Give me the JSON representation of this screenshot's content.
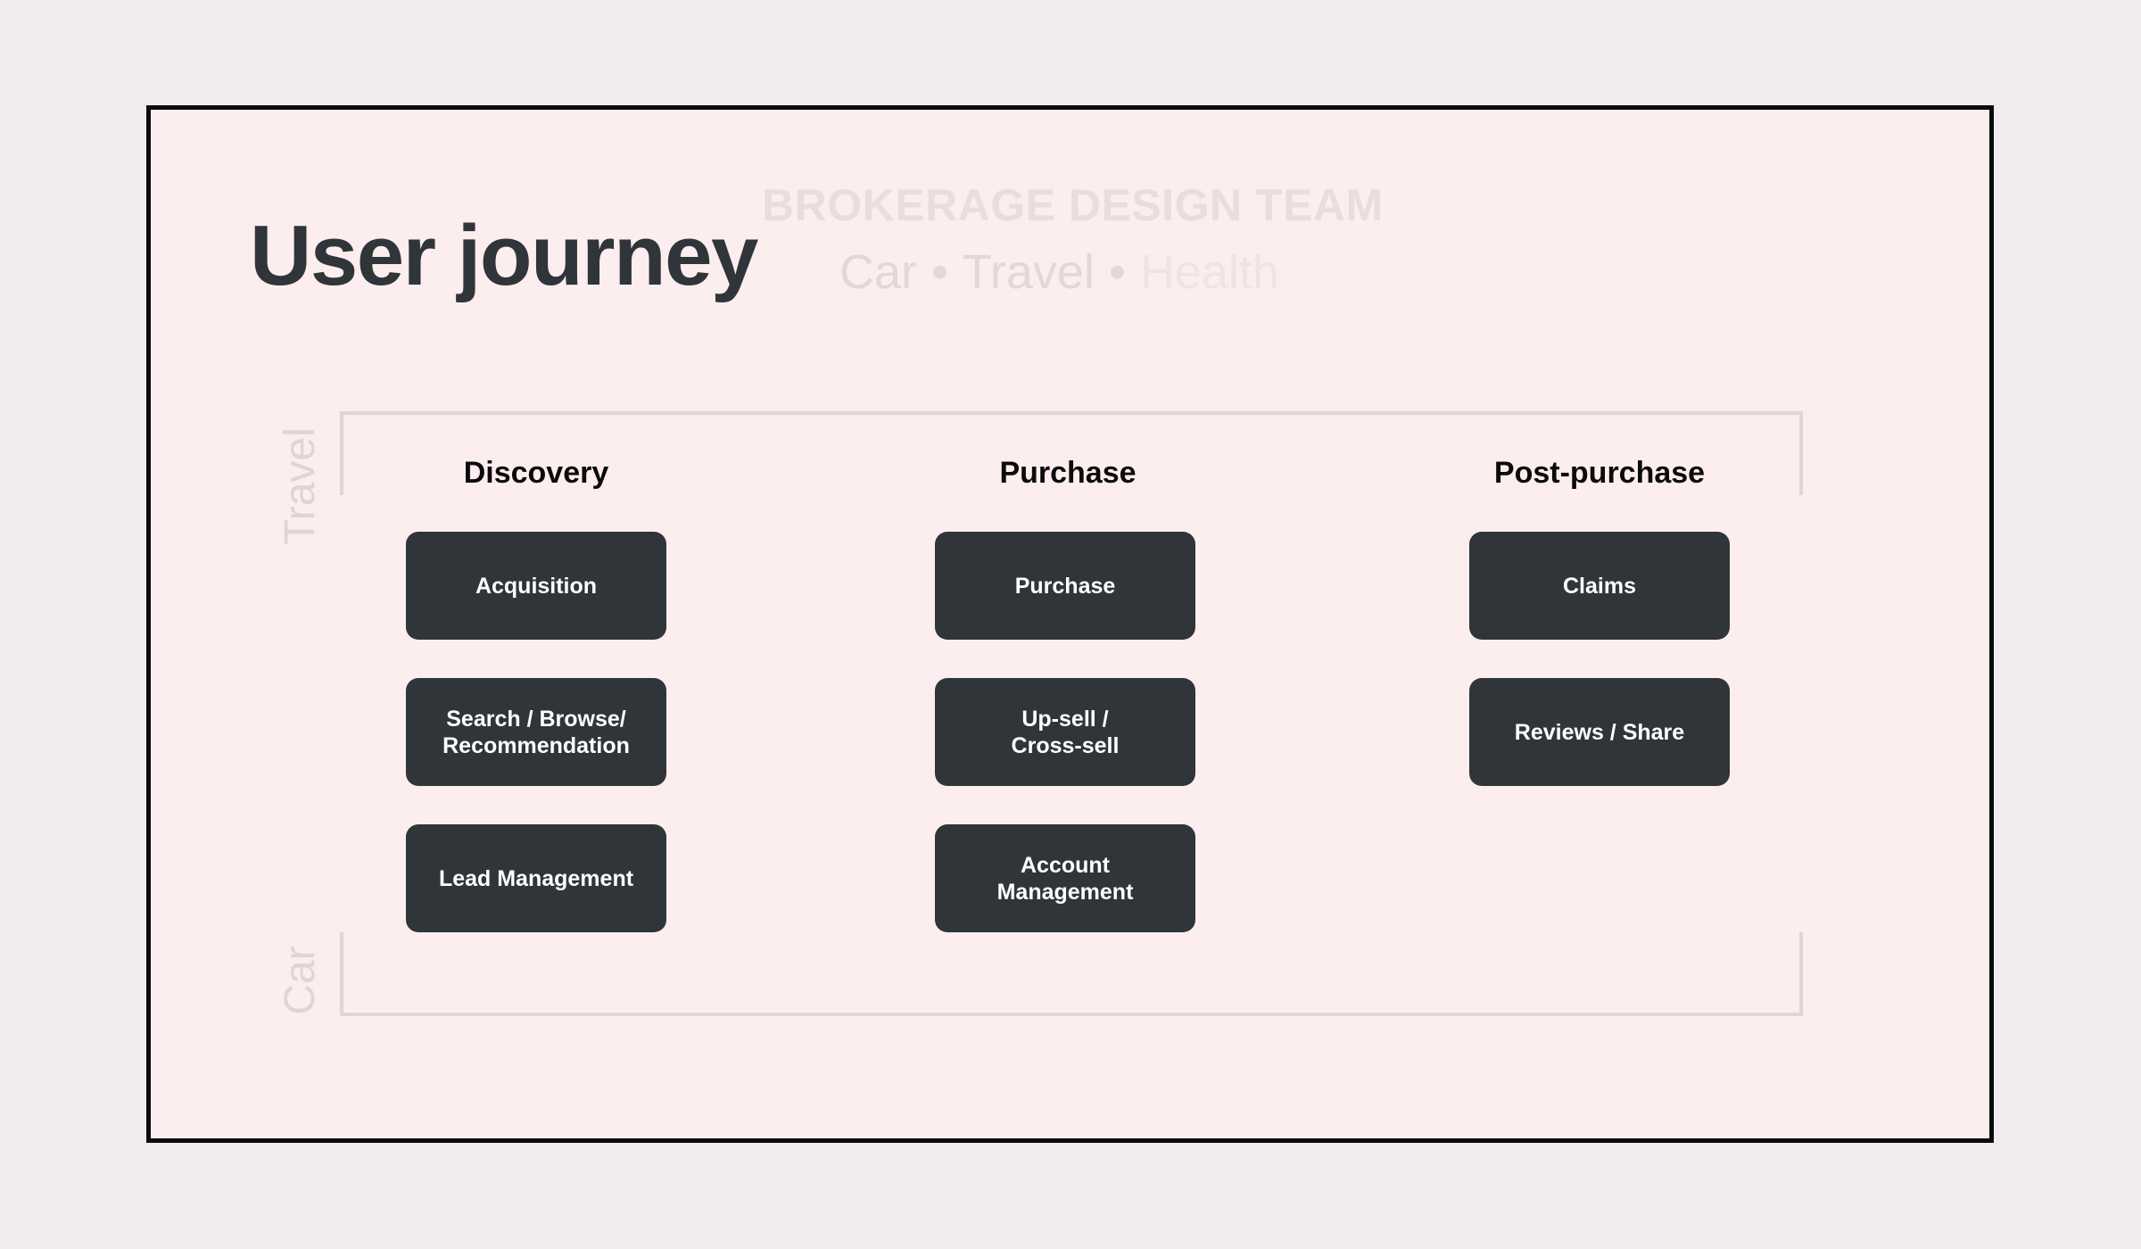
{
  "header": {
    "team": "BROKERAGE DESIGN TEAM",
    "title": "User journey",
    "subtitle": {
      "car": "Car",
      "dot": "•",
      "travel": "Travel",
      "health": "Health"
    }
  },
  "side_labels": {
    "top": "Travel",
    "bottom": "Car"
  },
  "columns": [
    {
      "heading": "Discovery",
      "cards": [
        {
          "line1": "Acquisition",
          "line2": ""
        },
        {
          "line1": "Search / Browse/",
          "line2": "Recommendation"
        },
        {
          "line1": "Lead Management",
          "line2": ""
        }
      ]
    },
    {
      "heading": "Purchase",
      "cards": [
        {
          "line1": "Purchase",
          "line2": ""
        },
        {
          "line1": "Up-sell /",
          "line2": "Cross-sell"
        },
        {
          "line1": "Account",
          "line2": "Management"
        }
      ]
    },
    {
      "heading": "Post-purchase",
      "cards": [
        {
          "line1": "Claims",
          "line2": ""
        },
        {
          "line1": "Reviews / Share",
          "line2": ""
        }
      ]
    }
  ],
  "colors": {
    "card": "#2f3539",
    "panel": "#fcedee",
    "background": "#f1ebf0"
  }
}
